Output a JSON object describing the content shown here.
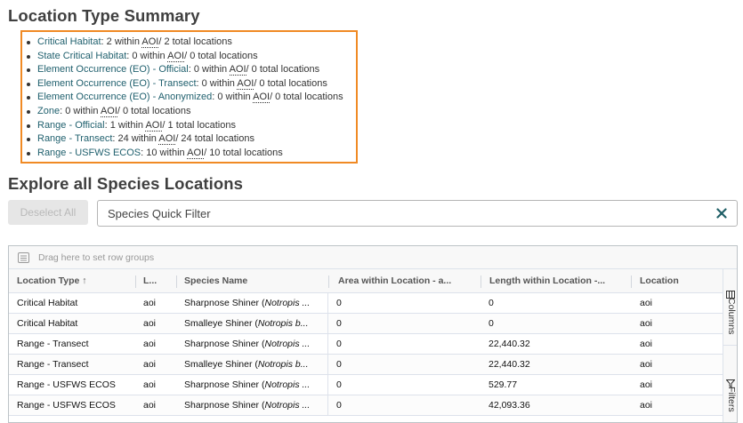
{
  "summary": {
    "title": "Location Type Summary",
    "items": [
      {
        "type": "Critical Habitat",
        "within": ": 2 within ",
        "abbr": "AOI",
        "total": "/ 2 total locations"
      },
      {
        "type": "State Critical Habitat",
        "within": ": 0 within ",
        "abbr": "AOI",
        "total": "/ 0 total locations"
      },
      {
        "type": "Element Occurrence (EO) - Official",
        "within": ": 0 within ",
        "abbr": "AOI",
        "total": "/ 0 total locations"
      },
      {
        "type": "Element Occurrence (EO) - Transect",
        "within": ": 0 within ",
        "abbr": "AOI",
        "total": "/ 0 total locations"
      },
      {
        "type": "Element Occurrence (EO) - Anonymized",
        "within": ": 0 within ",
        "abbr": "AOI",
        "total": "/ 0 total locations"
      },
      {
        "type": "Zone",
        "within": ": 0 within ",
        "abbr": "AOI",
        "total": "/ 0 total locations"
      },
      {
        "type": "Range - Official",
        "within": ": 1 within ",
        "abbr": "AOI",
        "total": "/ 1 total locations"
      },
      {
        "type": "Range - Transect",
        "within": ": 24 within ",
        "abbr": "AOI",
        "total": "/ 24 total locations"
      },
      {
        "type": "Range - USFWS ECOS",
        "within": ": 10 within ",
        "abbr": "AOI",
        "total": "/ 10 total locations"
      }
    ]
  },
  "explore": {
    "title": "Explore all Species Locations",
    "deselect_label": "Deselect All",
    "filter_placeholder": "Species Quick Filter",
    "filter_value": ""
  },
  "grid": {
    "group_panel_text": "Drag here to set row groups",
    "columns": [
      "Location Type ↑",
      "L...",
      "Species Name",
      "Area within Location - a...",
      "Length within Location -...",
      "Location"
    ],
    "side_tabs": [
      "Columns",
      "Filters"
    ],
    "rows": [
      {
        "type": "Critical Habitat",
        "loc": "aoi",
        "common": "Sharpnose Shiner (",
        "sci": "Notropis ...",
        "area": "0",
        "length": "0",
        "location": "aoi"
      },
      {
        "type": "Critical Habitat",
        "loc": "aoi",
        "common": "Smalleye Shiner (",
        "sci": "Notropis b...",
        "area": "0",
        "length": "0",
        "location": "aoi"
      },
      {
        "type": "Range - Transect",
        "loc": "aoi",
        "common": "Sharpnose Shiner (",
        "sci": "Notropis ...",
        "area": "0",
        "length": "22,440.32",
        "location": "aoi"
      },
      {
        "type": "Range - Transect",
        "loc": "aoi",
        "common": "Smalleye Shiner (",
        "sci": "Notropis b...",
        "area": "0",
        "length": "22,440.32",
        "location": "aoi"
      },
      {
        "type": "Range - USFWS ECOS",
        "loc": "aoi",
        "common": "Sharpnose Shiner (",
        "sci": "Notropis ...",
        "area": "0",
        "length": "529.77",
        "location": "aoi"
      },
      {
        "type": "Range - USFWS ECOS",
        "loc": "aoi",
        "common": "Sharpnose Shiner (",
        "sci": "Notropis ...",
        "area": "0",
        "length": "42,093.36",
        "location": "aoi"
      }
    ]
  },
  "colors": {
    "highlight_border": "#f08a24",
    "link": "#20606e",
    "clear_icon": "#1f5f66"
  },
  "icons": {
    "clear": "close-icon",
    "group": "row-group-icon",
    "sort": "sort-ascending-icon",
    "columns": "columns-icon",
    "filters": "filter-icon"
  }
}
